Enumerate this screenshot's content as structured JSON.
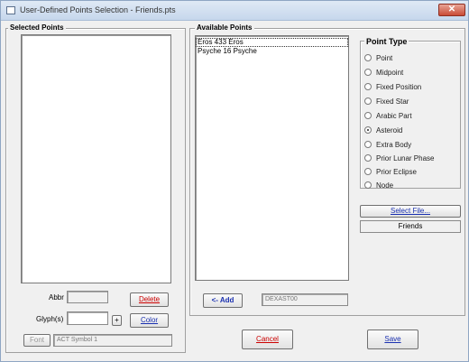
{
  "window": {
    "title": "User-Defined Points Selection - Friends.pts",
    "close_symbol": "✕"
  },
  "selected_points": {
    "group_title": "Selected Points",
    "items": []
  },
  "available_points": {
    "group_title": "Available Points",
    "items": [
      "Eros 433  Eros",
      "Psyche 16  Psyche"
    ],
    "selected_index": 0
  },
  "point_type": {
    "group_title": "Point Type",
    "options": [
      "Point",
      "Midpoint",
      "Fixed Position",
      "Fixed Star",
      "Arabic Part",
      "Asteroid",
      "Extra Body",
      "Prior Lunar Phase",
      "Prior Eclipse",
      "Node"
    ],
    "selected": "Asteroid",
    "select_file_label": "Select File...",
    "file_name": "Friends"
  },
  "abbr": {
    "label": "Abbr",
    "value": ""
  },
  "glyph": {
    "label": "Glyph(s)",
    "value": "",
    "spin_symbol": "+"
  },
  "buttons": {
    "delete": "Delete",
    "color": "Color",
    "font": "Font",
    "add": "<- Add",
    "cancel": "Cancel",
    "save": "Save"
  },
  "font_field": "ACT Symbol 1",
  "add_field": "DEXAST00"
}
